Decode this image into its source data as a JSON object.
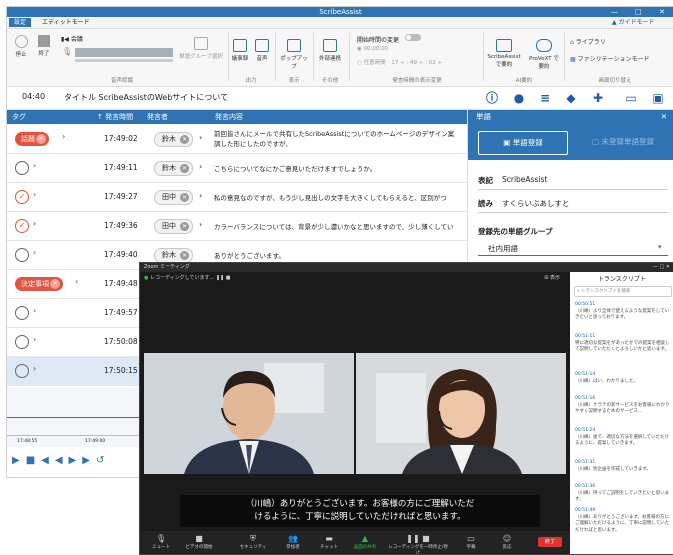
{
  "app": {
    "title": "ScribeAssist",
    "window_controls": [
      "—",
      "□",
      "✕"
    ],
    "menus": [
      {
        "label": "設定",
        "active": true
      },
      {
        "label": "エディットモード",
        "active": false
      }
    ],
    "menu_right": "▲ ガイドモード"
  },
  "ribbon": {
    "audio": {
      "stop": "停止",
      "end": "終了",
      "level_label": "会議",
      "group": "音声認識"
    },
    "word_group_select": "単語グループ選択",
    "output": {
      "items": [
        "議事録",
        "音声"
      ],
      "group": "出力"
    },
    "display": {
      "items": [
        "ポップアップ"
      ],
      "group": "表示"
    },
    "other": {
      "items": [
        "外部連携"
      ],
      "group": "その他"
    },
    "time_settings": {
      "label": "開始時間の変更",
      "option1": "00:00:00",
      "option2": "任意時間",
      "h": "17",
      "m": "49",
      "s": "02",
      "group": "発言時間の表示変更"
    },
    "ai": {
      "items": [
        "ScribeAssist で要約",
        "ProVoXT で要約"
      ],
      "group": "AI要約"
    },
    "mode": {
      "items": [
        "ライブラリ",
        "ファシリテーションモード"
      ],
      "group": "画面切り替え"
    }
  },
  "doc": {
    "time": "04:40",
    "title_label": "タイトル",
    "title_value": "ScribeAssistのWebサイトについて"
  },
  "table": {
    "headers": {
      "tag": "タグ",
      "time": "↑ 発言時間",
      "speaker": "発言者",
      "content": "発言内容"
    },
    "rows": [
      {
        "tag": "話題",
        "time": "17:49:02",
        "speaker": "鈴木",
        "text": "前回皆さんにメールで共有したScribeAssistについてのホームページのデザイン案",
        "text2": "調した形にしたのですが、",
        "type": "tag"
      },
      {
        "tag": "",
        "time": "17:49:11",
        "speaker": "鈴木",
        "text": "こちらについてなにかご意見いただけますでしょうか。",
        "type": "circle"
      },
      {
        "tag": "",
        "time": "17:49:27",
        "speaker": "田中",
        "text": "私の意見なのですが、もう少し見出しの文字を大きくしてもらえると、区別がつ",
        "type": "check"
      },
      {
        "tag": "",
        "time": "17:49:36",
        "speaker": "田中",
        "text": "カラーバランスについては、背景が少し濃いかなと思いますので、少し薄くしてい",
        "type": "check"
      },
      {
        "tag": "",
        "time": "17:49:40",
        "speaker": "鈴木",
        "text": "ありがとうございます。",
        "type": "circle"
      },
      {
        "tag": "決定事項",
        "time": "17:49:48",
        "speaker": "",
        "text": "",
        "type": "tag"
      },
      {
        "tag": "",
        "time": "17:49:57",
        "speaker": "",
        "text": "",
        "type": "circle"
      },
      {
        "tag": "",
        "time": "17:50:08",
        "speaker": "",
        "text": "",
        "type": "circle"
      },
      {
        "tag": "",
        "time": "17:50:15",
        "speaker": "",
        "text": "",
        "type": "circle"
      }
    ]
  },
  "waveform": {
    "t1": "17:48:55",
    "t2": "17:49:00"
  },
  "panel": {
    "title": "単語",
    "tab_register": "単語登録",
    "tab_unregistered": "未登録単語登録",
    "notation_label": "表記",
    "notation_value": "ScribeAssist",
    "reading_label": "読み",
    "reading_value": "すくらいぶあしすと",
    "group_label": "登録先の単語グループ",
    "group_value": "社内用語"
  },
  "zoom": {
    "title": "Zoom ミーティング",
    "bar_label": "レコーディングしています...",
    "view_label": "表示",
    "caption1": "（川嶋）ありがとうございます。お客様の方にご理解いただ",
    "caption2": "けるように、丁寧に説明していただければと思います。",
    "controls": [
      "ミュート",
      "ビデオの開始",
      "セキュリティ",
      "参加者",
      "チャット",
      "画面の共有",
      "レコーディングを一時停止/停止",
      "字幕",
      "反応"
    ],
    "leave": "終了",
    "transcript_title": "トランスクリプト",
    "transcript_search": "トランスクリプトを検索",
    "entries": [
      {
        "t": "00:50:51",
        "s": "（川嶋）より全体で使えるような提案をしていきたいと思っております。"
      },
      {
        "t": "00:51:11",
        "s": "特に適切な提案をがあったかでの提案を相談して説明していただくとよろしいかと思います。"
      },
      {
        "t": "00:51:14",
        "s": "（川嶋）はい、わかりました。"
      },
      {
        "t": "00:51:16",
        "s": "（川嶋）ナラテの新サービスをお客様にわかりやすく説明するためのサービス..."
      },
      {
        "t": "00:51:24",
        "s": "（川嶋）後で、適切な方法を選択していただけるように、提案していきます。"
      },
      {
        "t": "00:51:31",
        "s": "（川嶋）別企画を作成していきます。"
      },
      {
        "t": "00:51:36",
        "s": "（川嶋）持ってご説明をしていきたいと思います。"
      },
      {
        "t": "00:51:49",
        "s": "（川嶋）ありがとうございます。お客様の方にご理解いただけるように、丁寧に説明していただければと思います。"
      }
    ]
  }
}
